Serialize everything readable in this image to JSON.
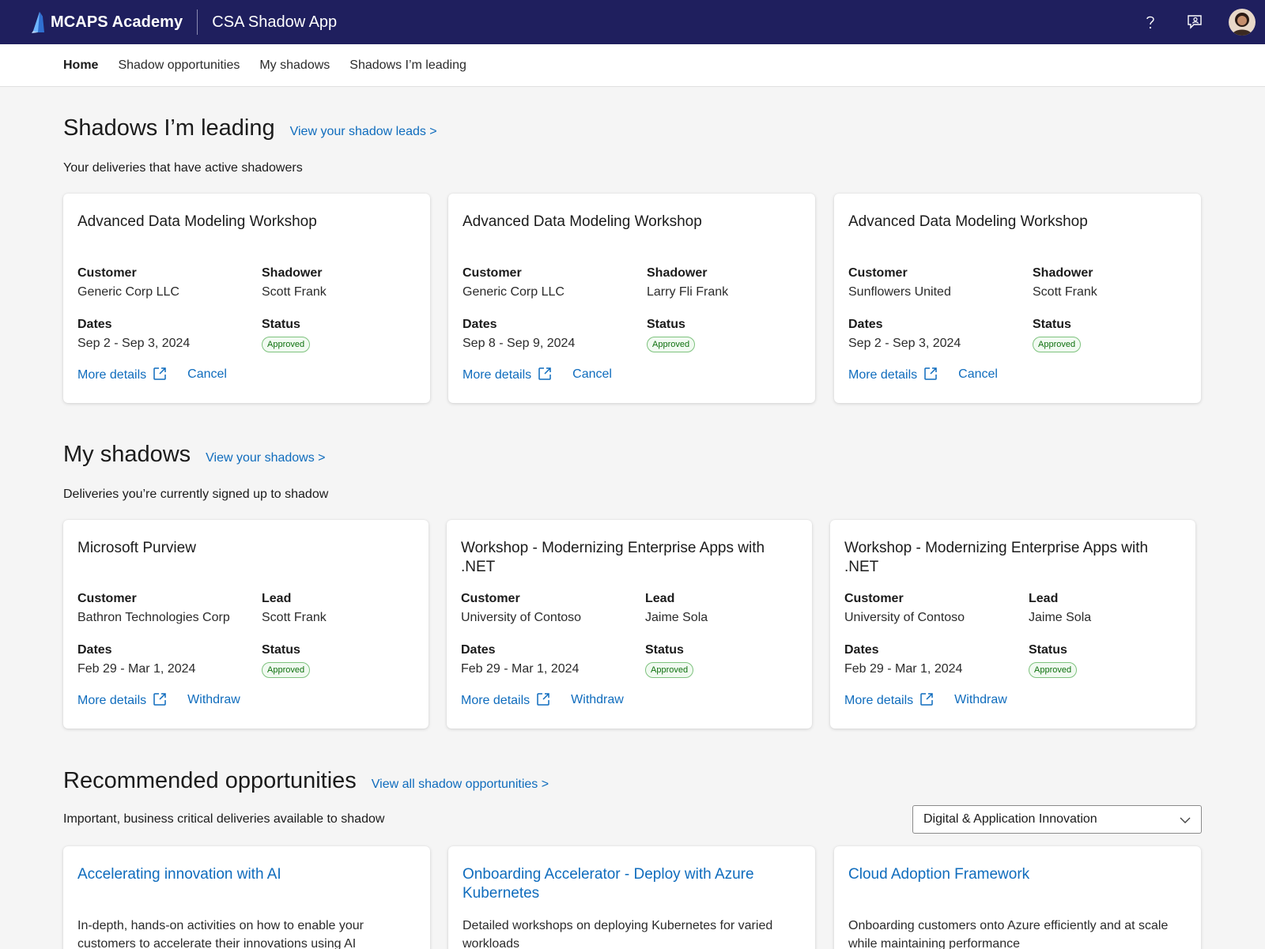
{
  "header": {
    "brand": "MCAPS Academy",
    "app_name": "CSA Shadow App",
    "help_icon": "question-icon",
    "feedback_icon": "feedback-icon"
  },
  "nav": {
    "items": [
      "Home",
      "Shadow opportunities",
      "My shadows",
      "Shadows I’m leading"
    ]
  },
  "leading": {
    "title": "Shadows I’m leading",
    "link": "View your shadow leads >",
    "subtitle": "Your deliveries that have active shadowers",
    "cards": [
      {
        "title": "Advanced Data Modeling Workshop",
        "customer_label": "Customer",
        "customer": "Generic Corp LLC",
        "person_label": "Shadower",
        "person": "Scott Frank",
        "dates_label": "Dates",
        "dates": "Sep 2 - Sep 3, 2024",
        "status_label": "Status",
        "status": "Approved",
        "details": "More details",
        "secondary": "Cancel"
      },
      {
        "title": "Advanced Data Modeling Workshop",
        "customer_label": "Customer",
        "customer": "Generic Corp LLC",
        "person_label": "Shadower",
        "person": "Larry Fli Frank",
        "dates_label": "Dates",
        "dates": "Sep 8 - Sep 9, 2024",
        "status_label": "Status",
        "status": "Approved",
        "details": "More details",
        "secondary": "Cancel"
      },
      {
        "title": "Advanced Data Modeling Workshop",
        "customer_label": "Customer",
        "customer": "Sunflowers United",
        "person_label": "Shadower",
        "person": "Scott Frank",
        "dates_label": "Dates",
        "dates": "Sep 2 - Sep 3, 2024",
        "status_label": "Status",
        "status": "Approved",
        "details": "More details",
        "secondary": "Cancel"
      }
    ]
  },
  "shadows": {
    "title": "My shadows",
    "link": "View your shadows >",
    "subtitle": "Deliveries you’re currently signed up to shadow",
    "cards": [
      {
        "title": "Microsoft Purview",
        "customer_label": "Customer",
        "customer": "Bathron Technologies Corp",
        "person_label": "Lead",
        "person": "Scott Frank",
        "dates_label": "Dates",
        "dates": "Feb 29 - Mar 1, 2024",
        "status_label": "Status",
        "status": "Approved",
        "details": "More details",
        "secondary": "Withdraw"
      },
      {
        "title": "Workshop - Modernizing Enterprise Apps with .NET",
        "customer_label": "Customer",
        "customer": "University of Contoso",
        "person_label": "Lead",
        "person": "Jaime Sola",
        "dates_label": "Dates",
        "dates": "Feb 29 - Mar 1, 2024",
        "status_label": "Status",
        "status": "Approved",
        "details": "More details",
        "secondary": "Withdraw"
      },
      {
        "title": "Workshop - Modernizing Enterprise Apps with .NET",
        "customer_label": "Customer",
        "customer": "University of Contoso",
        "person_label": "Lead",
        "person": "Jaime Sola",
        "dates_label": "Dates",
        "dates": "Feb 29 - Mar 1, 2024",
        "status_label": "Status",
        "status": "Approved",
        "details": "More details",
        "secondary": "Withdraw"
      }
    ]
  },
  "recommended": {
    "title": "Recommended opportunities",
    "link": "View all shadow opportunities >",
    "subtitle": "Important, business critical deliveries available to shadow",
    "filter_value": "Digital & Application Innovation",
    "cards": [
      {
        "title": "Accelerating innovation with AI",
        "desc": "In-depth, hands-on activities on how to enable your customers to accelerate their innovations using AI"
      },
      {
        "title": "Onboarding Accelerator - Deploy with Azure Kubernetes",
        "desc": "Detailed workshops on deploying Kubernetes for varied workloads"
      },
      {
        "title": "Cloud Adoption Framework",
        "desc": "Onboarding customers onto Azure efficiently and at scale while maintaining performance"
      }
    ]
  },
  "colors": {
    "header_bg": "#1f1f5e",
    "link": "#0f6cbd",
    "badge_text": "#0e700e",
    "page_bg": "#f5f5f5"
  }
}
